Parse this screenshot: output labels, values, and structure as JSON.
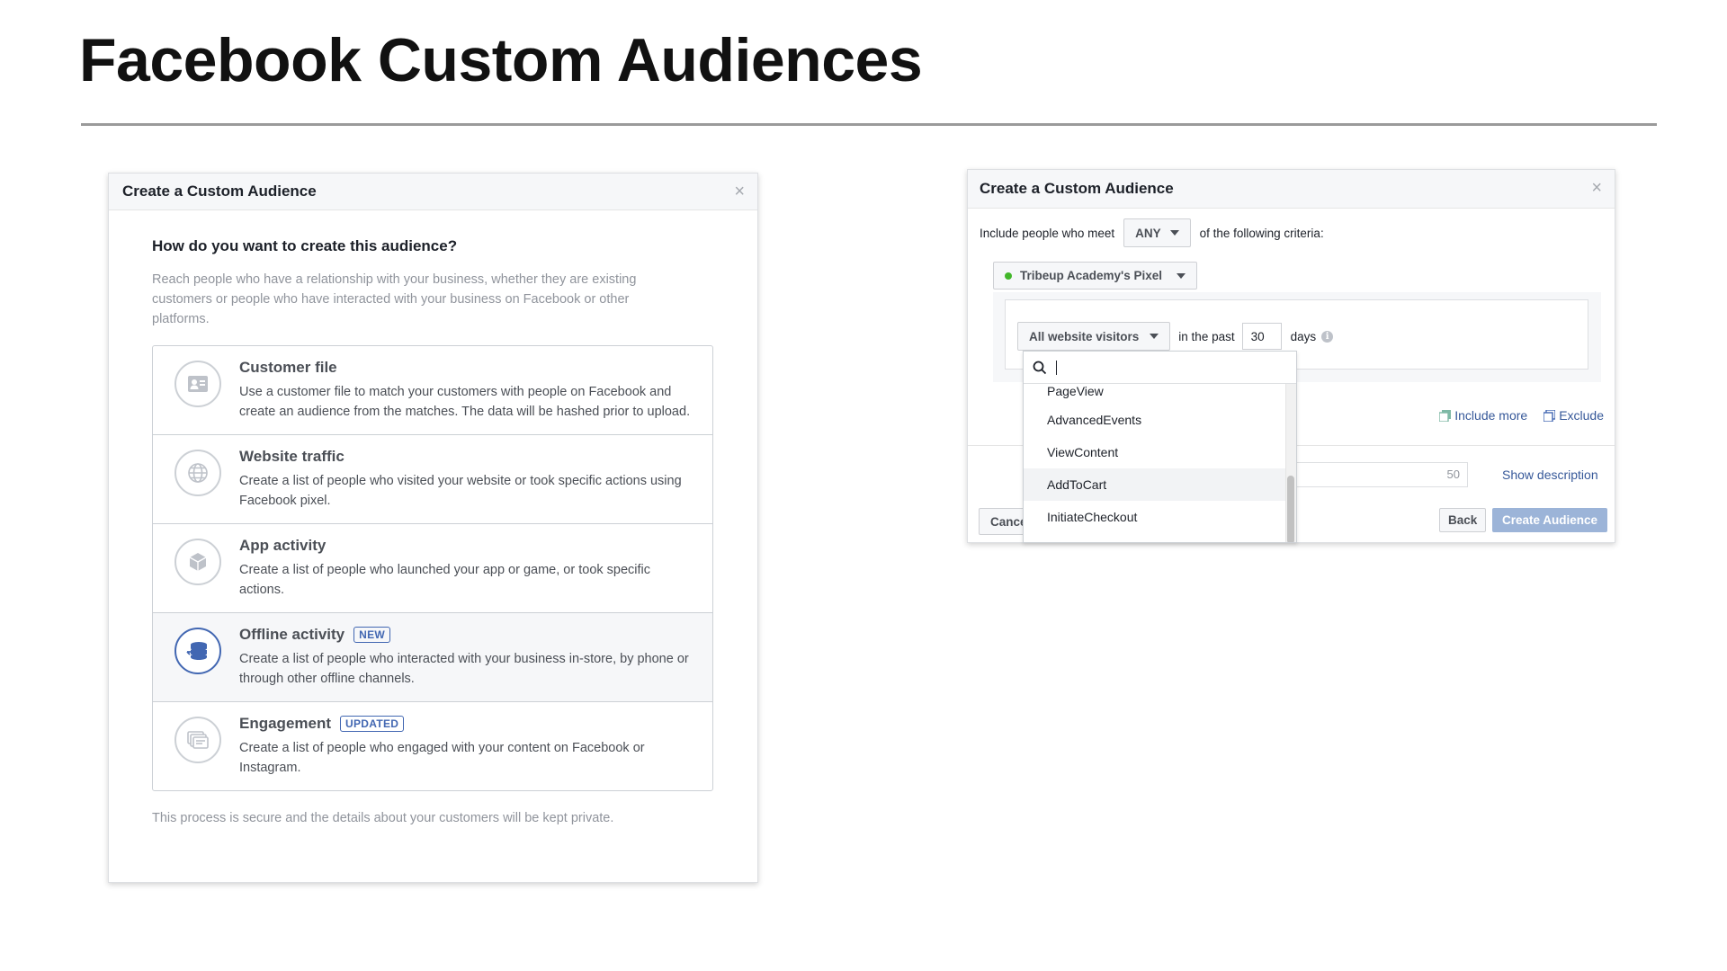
{
  "slide": {
    "title": "Facebook Custom Audiences"
  },
  "left_dialog": {
    "title": "Create a Custom Audience",
    "close": "×",
    "question": "How do you want to create this audience?",
    "description": "Reach people who have a relationship with your business, whether they are existing customers or people who have interacted with your business on Facebook or other platforms.",
    "options": [
      {
        "title": "Customer file",
        "badge": "",
        "icon": "contact-card-icon",
        "description": "Use a customer file to match your customers with people on Facebook and create an audience from the matches. The data will be hashed prior to upload."
      },
      {
        "title": "Website traffic",
        "badge": "",
        "icon": "globe-icon",
        "description": "Create a list of people who visited your website or took specific actions using Facebook pixel."
      },
      {
        "title": "App activity",
        "badge": "",
        "icon": "cube-icon",
        "description": "Create a list of people who launched your app or game, or took specific actions."
      },
      {
        "title": "Offline activity",
        "badge": "NEW",
        "icon": "database-icon",
        "description": "Create a list of people who interacted with your business in-store, by phone or through other offline channels."
      },
      {
        "title": "Engagement",
        "badge": "UPDATED",
        "icon": "cards-icon",
        "description": "Create a list of people who engaged with your content on Facebook or Instagram."
      }
    ],
    "footnote": "This process is secure and the details about your customers will be kept private."
  },
  "right_dialog": {
    "title": "Create a Custom Audience",
    "close": "×",
    "criteria_prefix": "Include people who meet",
    "criteria_match": "ANY",
    "criteria_suffix": "of the following criteria:",
    "pixel_name": "Tribeup Academy's Pixel",
    "rule_event": "All website visitors",
    "rule_in_past": "in the past",
    "rule_days_value": "30",
    "rule_days_label": "days",
    "include_more": "Include more",
    "exclude": "Exclude",
    "name_counter": "50",
    "show_description": "Show description",
    "cancel": "Cancel",
    "back": "Back",
    "create": "Create Audience"
  },
  "dropdown": {
    "items": [
      "PageView",
      "AdvancedEvents",
      "ViewContent",
      "AddToCart",
      "InitiateCheckout"
    ]
  },
  "colors": {
    "accent": "#4267b2",
    "link": "#365899",
    "pixel_active": "#42b72a",
    "disabled_button": "#9cb4d8"
  }
}
